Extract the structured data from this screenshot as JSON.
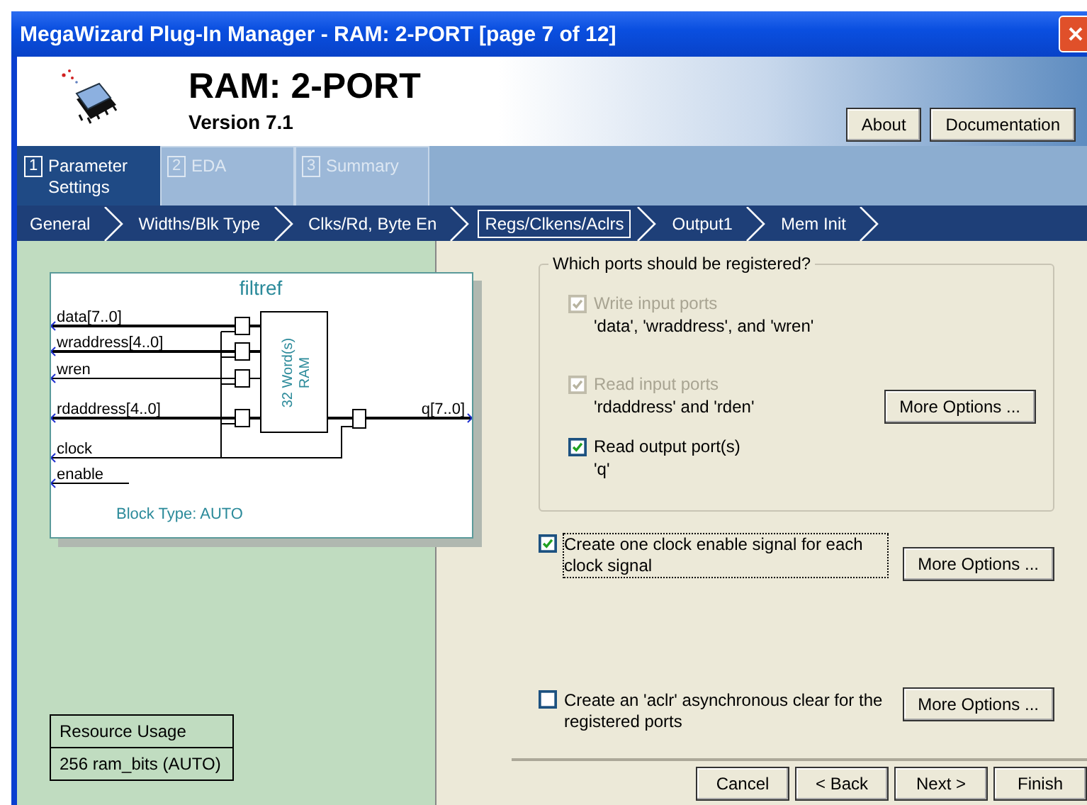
{
  "window": {
    "title": "MegaWizard Plug-In Manager - RAM: 2-PORT [page 7 of 12]"
  },
  "header": {
    "title": "RAM: 2-PORT",
    "version": "Version 7.1",
    "buttons": [
      {
        "label": "About"
      },
      {
        "label": "Documentation"
      }
    ]
  },
  "steps": [
    {
      "number": "1",
      "label": "Parameter Settings",
      "selected": true
    },
    {
      "number": "2",
      "label": "EDA",
      "selected": false
    },
    {
      "number": "3",
      "label": "Summary",
      "selected": false
    }
  ],
  "breadcrumbs": [
    {
      "label": "General",
      "selected": false
    },
    {
      "label": "Widths/Blk Type",
      "selected": false
    },
    {
      "label": "Clks/Rd, Byte En",
      "selected": false
    },
    {
      "label": "Regs/Clkens/Aclrs",
      "selected": true
    },
    {
      "label": "Output1",
      "selected": false
    },
    {
      "label": "Mem Init",
      "selected": false
    }
  ],
  "diagram": {
    "title": "filtref",
    "inputs": [
      "data[7..0]",
      "wraddress[4..0]",
      "wren",
      "rdaddress[4..0]",
      "clock",
      "enable"
    ],
    "output": "q[7..0]",
    "ram_label": [
      "32 Word(s)",
      "RAM"
    ],
    "block_type": "Block Type: AUTO"
  },
  "resource_usage": {
    "heading": "Resource Usage",
    "value": "256 ram_bits (AUTO)"
  },
  "register_group": {
    "legend": "Which ports should be registered?",
    "options": [
      {
        "label": "Write input ports",
        "detail": "'data', 'wraddress', and 'wren'",
        "checked": true,
        "disabled": true
      },
      {
        "label": "Read input ports",
        "detail": "'rdaddress' and 'rden'",
        "checked": true,
        "disabled": true,
        "more_options": "More Options ..."
      },
      {
        "label": "Read output port(s)",
        "detail": "'q'",
        "checked": true,
        "disabled": false
      }
    ]
  },
  "clock_enable": {
    "label": "Create one clock enable signal for each clock signal",
    "checked": true,
    "focused": true,
    "more_options": "More Options ..."
  },
  "aclr": {
    "label": "Create an 'aclr' asynchronous clear for the registered ports",
    "checked": false,
    "focused": false,
    "more_options": "More Options ..."
  },
  "footer_buttons": [
    {
      "label": "Cancel"
    },
    {
      "label": "< Back"
    },
    {
      "label": "Next >"
    },
    {
      "label": "Finish"
    }
  ]
}
